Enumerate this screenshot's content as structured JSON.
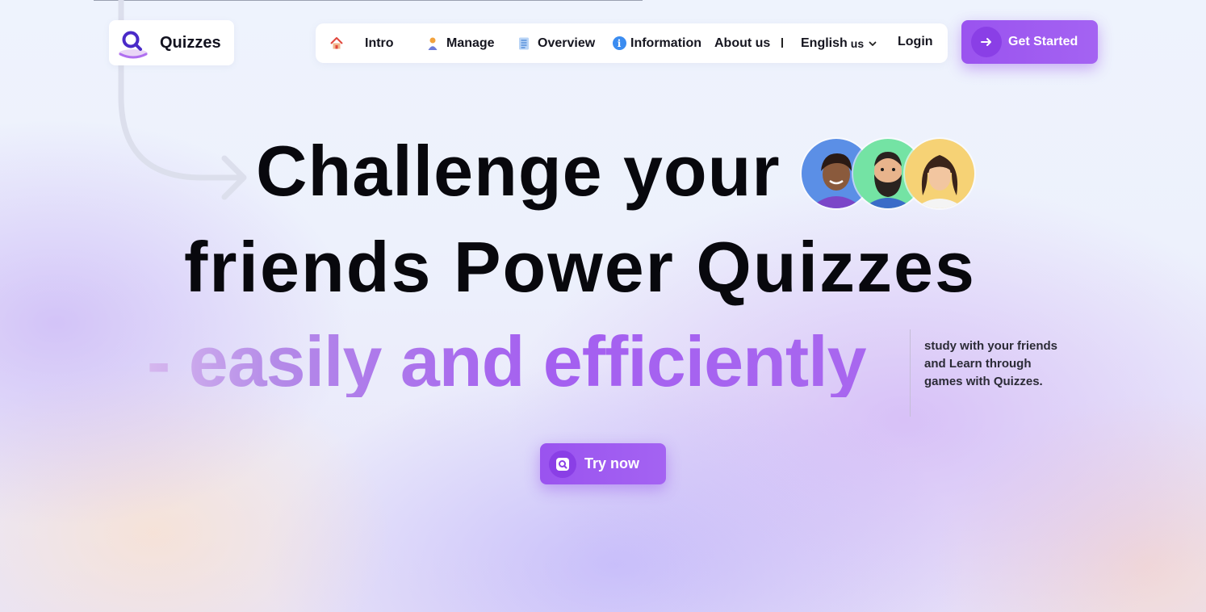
{
  "brand": {
    "name": "Quizzes"
  },
  "nav": {
    "items": [
      {
        "label": "Intro",
        "icon": "home-icon"
      },
      {
        "label": "Manage",
        "icon": "person-icon"
      },
      {
        "label": "Overview",
        "icon": "document-icon"
      },
      {
        "label": "Information",
        "icon": "info-icon"
      },
      {
        "label": "About us"
      }
    ],
    "language": {
      "label": "English",
      "suffix": "us"
    },
    "login": "Login"
  },
  "cta": {
    "get_started": "Get Started",
    "try_now": "Try now"
  },
  "hero": {
    "line1": "Challenge your",
    "line2": "friends Power Quizzes",
    "line3": "- easily and efficiently",
    "side_note": "study with your friends and Learn through games with Quizzes."
  },
  "colors": {
    "accent": "#9a53ef",
    "accent_dark": "#8a3fe6",
    "avatar_backgrounds": [
      "#5b8fe6",
      "#74e3a4",
      "#f6d275"
    ]
  }
}
